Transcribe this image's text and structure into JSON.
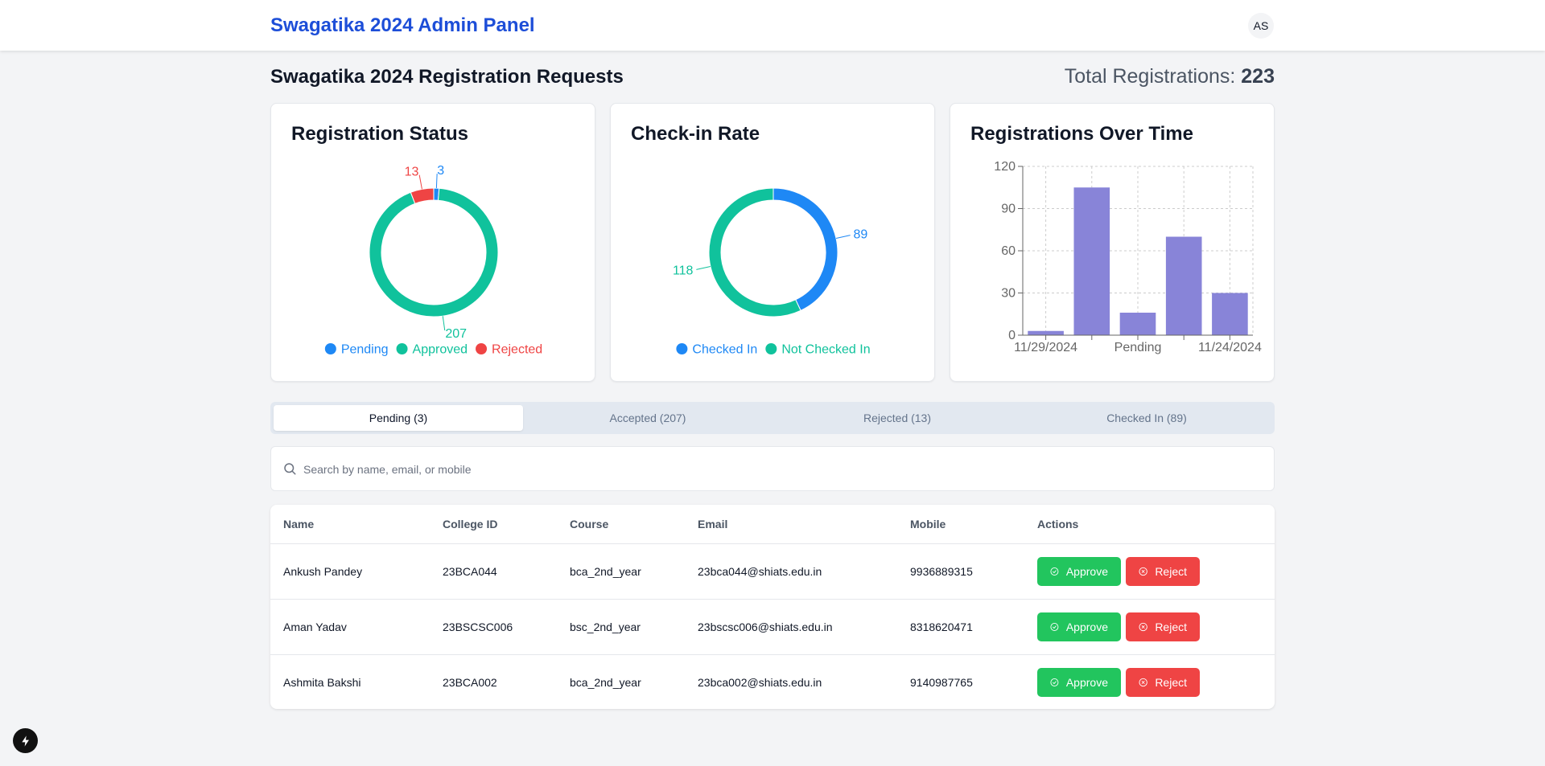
{
  "header": {
    "brand": "Swagatika 2024 Admin Panel",
    "avatar_initials": "AS"
  },
  "page": {
    "title": "Swagatika 2024 Registration Requests",
    "total_label": "Total Registrations:",
    "total_value": "223"
  },
  "cards": {
    "status": {
      "title": "Registration Status"
    },
    "checkin": {
      "title": "Check-in Rate"
    },
    "over_time": {
      "title": "Registrations Over Time"
    }
  },
  "chart_data": [
    {
      "type": "pie",
      "title": "Registration Status",
      "donut": true,
      "slices": [
        {
          "label": "Pending",
          "value": 3,
          "color": "#1e88f5"
        },
        {
          "label": "Approved",
          "value": 207,
          "color": "#10c29c"
        },
        {
          "label": "Rejected",
          "value": 13,
          "color": "#ef4444"
        }
      ],
      "legend": "bottom"
    },
    {
      "type": "pie",
      "title": "Check-in Rate",
      "donut": true,
      "slices": [
        {
          "label": "Checked In",
          "value": 89,
          "color": "#1e88f5"
        },
        {
          "label": "Not Checked In",
          "value": 118,
          "color": "#10c29c"
        }
      ],
      "legend": "bottom"
    },
    {
      "type": "bar",
      "title": "Registrations Over Time",
      "categories": [
        "11/29/2024",
        "",
        "Pending",
        "",
        "11/24/2024"
      ],
      "values": [
        3,
        105,
        16,
        70,
        30
      ],
      "ylim": [
        0,
        120
      ],
      "yticks": [
        0,
        30,
        60,
        90,
        120
      ],
      "grid": true,
      "color": "#8884d8"
    }
  ],
  "tabs": [
    {
      "label": "Pending (3)",
      "active": true
    },
    {
      "label": "Accepted (207)",
      "active": false
    },
    {
      "label": "Rejected (13)",
      "active": false
    },
    {
      "label": "Checked In (89)",
      "active": false
    }
  ],
  "search": {
    "placeholder": "Search by name, email, or mobile",
    "icon": "search-icon"
  },
  "table": {
    "columns": [
      "Name",
      "College ID",
      "Course",
      "Email",
      "Mobile",
      "Actions"
    ],
    "rows": [
      {
        "name": "Ankush Pandey",
        "college_id": "23BCA044",
        "course": "bca_2nd_year",
        "email": "23bca044@shiats.edu.in",
        "mobile": "9936889315"
      },
      {
        "name": "Aman Yadav",
        "college_id": "23BSCSC006",
        "course": "bsc_2nd_year",
        "email": "23bscsc006@shiats.edu.in",
        "mobile": "8318620471"
      },
      {
        "name": "Ashmita Bakshi",
        "college_id": "23BCA002",
        "course": "bca_2nd_year",
        "email": "23bca002@shiats.edu.in",
        "mobile": "9140987765"
      }
    ],
    "approve_label": "Approve",
    "reject_label": "Reject"
  }
}
